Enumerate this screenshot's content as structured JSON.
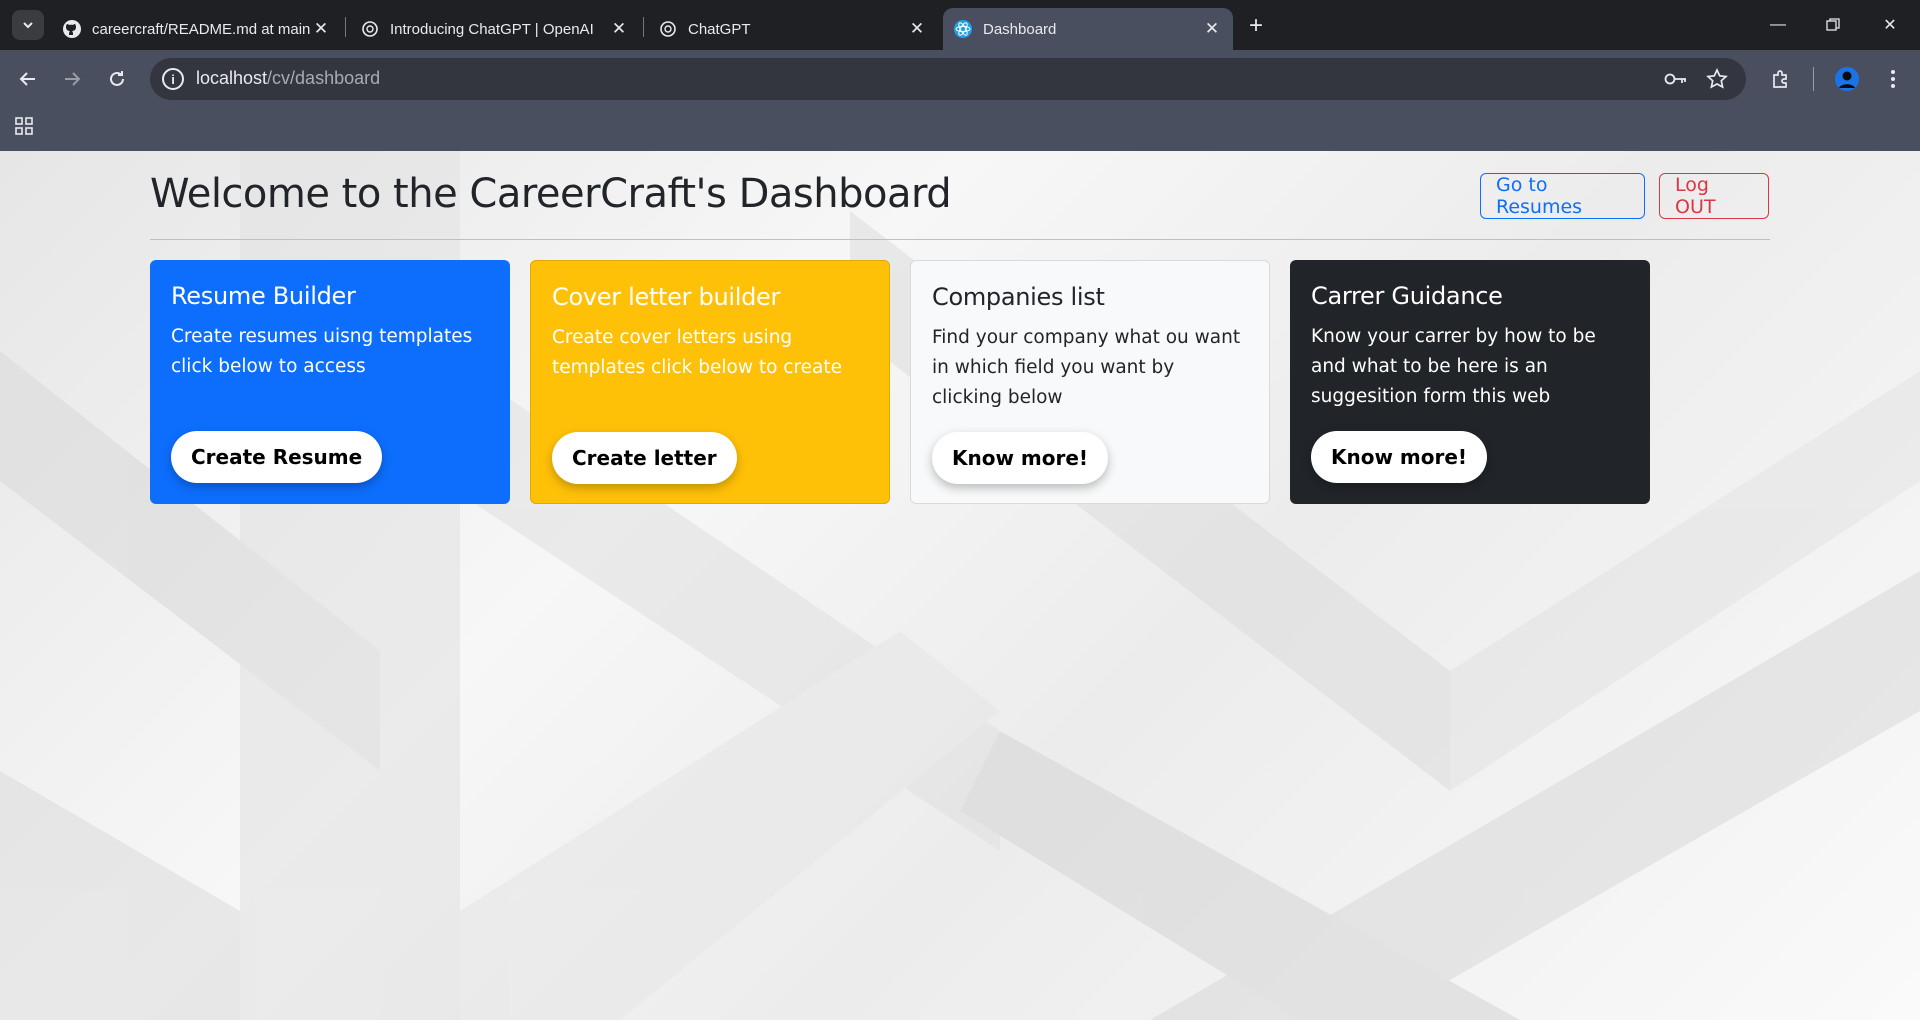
{
  "browser": {
    "tabs": [
      {
        "title": "careercraft/README.md at main",
        "favicon": "github-icon",
        "active": false
      },
      {
        "title": "Introducing ChatGPT | OpenAI",
        "favicon": "openai-icon",
        "active": false
      },
      {
        "title": "ChatGPT",
        "favicon": "openai-icon",
        "active": false
      },
      {
        "title": "Dashboard",
        "favicon": "react-icon",
        "active": true
      }
    ],
    "url_host": "localhost",
    "url_path": "/cv/dashboard"
  },
  "page": {
    "title": "Welcome to the CareerCraft's Dashboard",
    "go_resumes": "Go to Resumes",
    "logout": "Log OUT"
  },
  "cards": [
    {
      "title": "Resume Builder",
      "text": "Create resumes uisng templates click below to access",
      "button": "Create Resume",
      "color": "#0d6efd"
    },
    {
      "title": "Cover letter builder",
      "text": "Create cover letters using templates click below to create",
      "button": "Create letter",
      "color": "#ffc107"
    },
    {
      "title": "Companies list",
      "text": "Find your company what ou want in which field you want by clicking below",
      "button": "Know more!",
      "color": "#f8f9fa"
    },
    {
      "title": "Carrer Guidance",
      "text": "Know your carrer by how to be and what to be here is an suggesition form this web",
      "button": "Know more!",
      "color": "#212529"
    }
  ]
}
